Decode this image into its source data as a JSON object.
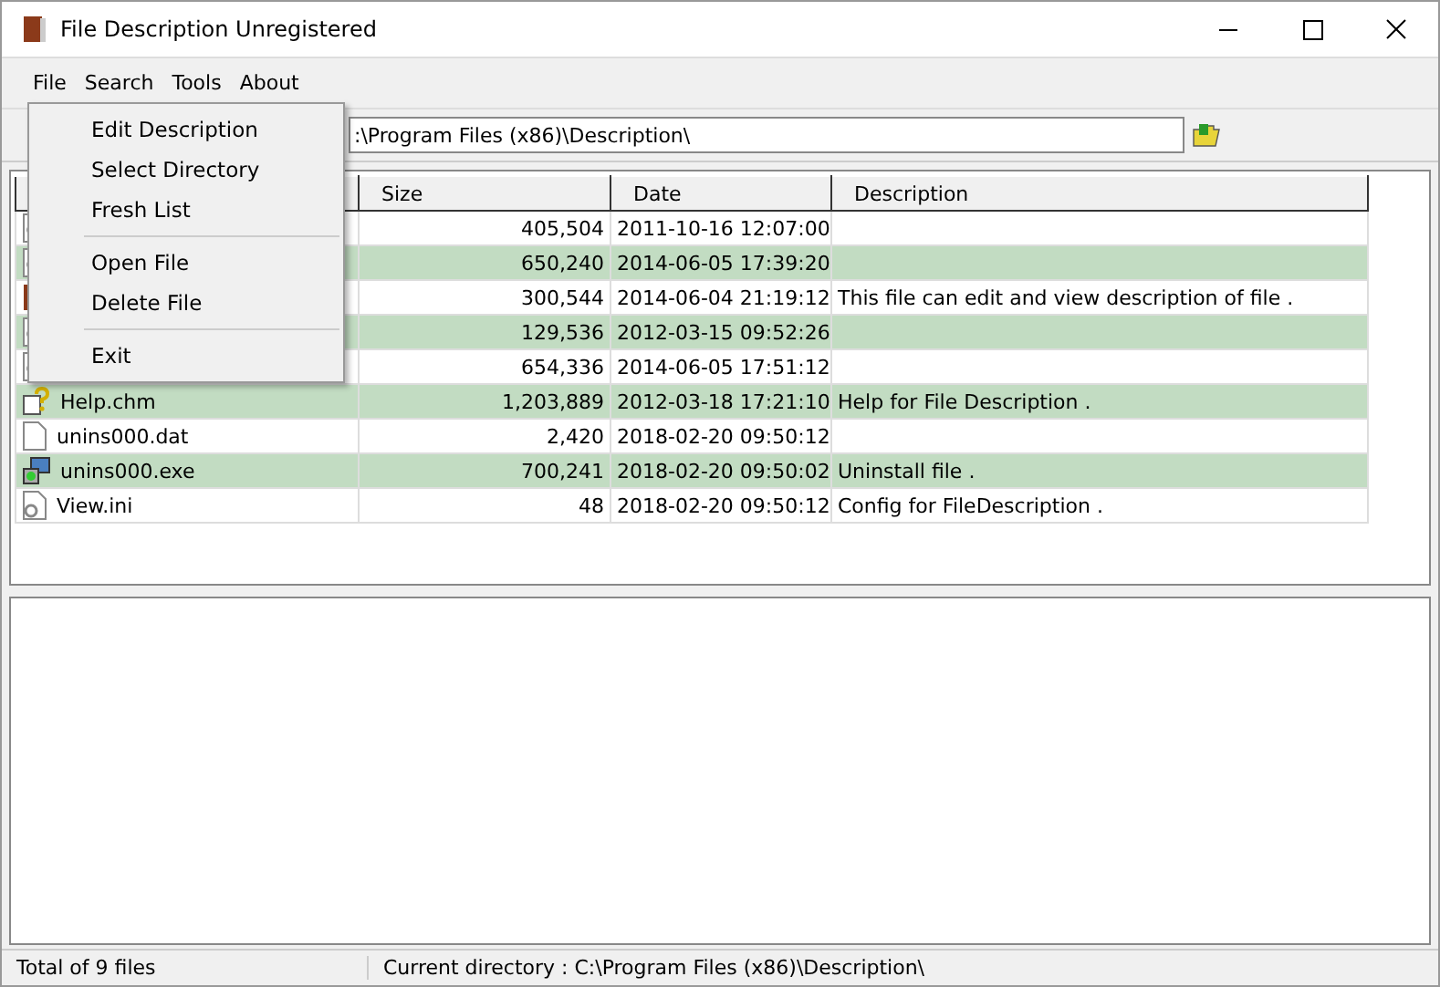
{
  "window": {
    "title": "File Description Unregistered"
  },
  "menu_bar": [
    "File",
    "Search",
    "Tools",
    "About"
  ],
  "open_menu": {
    "items": [
      {
        "kind": "entry",
        "label": "Edit Description"
      },
      {
        "kind": "entry",
        "label": "Select Directory"
      },
      {
        "kind": "entry",
        "label": "Fresh List"
      },
      {
        "kind": "separator"
      },
      {
        "kind": "entry",
        "label": "Open File"
      },
      {
        "kind": "entry",
        "label": "Delete File"
      },
      {
        "kind": "separator"
      },
      {
        "kind": "entry",
        "label": "Exit"
      }
    ]
  },
  "path_field": {
    "value": ":\\Program Files (x86)\\Description\\"
  },
  "table": {
    "columns": [
      "Size",
      "Date",
      "Description"
    ],
    "rows": [
      {
        "kind": "doc",
        "size": "405,504",
        "date": "2011-10-16 12:07:00"
      },
      {
        "kind": "doc",
        "size": "650,240",
        "date": "2014-06-05 17:39:20"
      },
      {
        "kind": "app",
        "size": "300,544",
        "date": "2014-06-04 21:19:12",
        "description": "This file can edit and view description of file ."
      },
      {
        "kind": "doc",
        "size": "129,536",
        "date": "2012-03-15 09:52:26"
      },
      {
        "kind": "doc",
        "size": "654,336",
        "date": "2014-06-05 17:51:12"
      },
      {
        "kind": "help",
        "name": "Help.chm",
        "size": "1,203,889",
        "date": "2012-03-18 17:21:10",
        "description": "Help for File Description ."
      },
      {
        "kind": "blank",
        "name": "unins000.dat",
        "size": "2,420",
        "date": "2018-02-20 09:50:12"
      },
      {
        "kind": "installer",
        "name": "unins000.exe",
        "size": "700,241",
        "date": "2018-02-20 09:50:02",
        "description": "Uninstall file ."
      },
      {
        "kind": "config",
        "name": "View.ini",
        "size": "48",
        "date": "2018-02-20 09:50:12",
        "description": "Config for FileDescription ."
      }
    ]
  },
  "status_bar": [
    "Total of 9 files",
    "Current directory : C:\\Program Files (x86)\\Description\\"
  ]
}
